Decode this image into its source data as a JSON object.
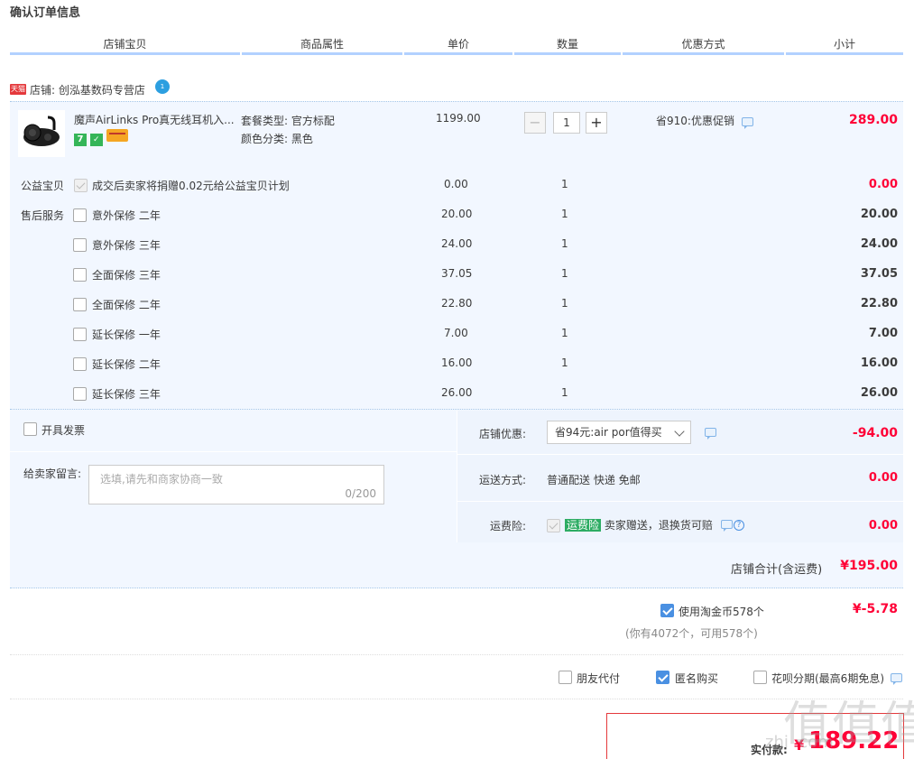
{
  "page_title": "确认订单信息",
  "columns": [
    "店铺宝贝",
    "商品属性",
    "单价",
    "数量",
    "优惠方式",
    "小计"
  ],
  "shop": {
    "badge": "天猫",
    "label": "店铺: 创泓基数码专营店",
    "ww_badge": "1"
  },
  "item": {
    "name": "魔声AirLinks Pro真无线耳机入...",
    "attr1": "套餐类型: 官方标配",
    "attr2": "颜色分类: 黑色",
    "price": "1199.00",
    "qty": "1",
    "discount": "省910:优惠促销",
    "subtotal": "289.00",
    "badge_icons": [
      "7-day-return-icon",
      "guarantee-icon",
      "credit-card-icon"
    ]
  },
  "charity": {
    "label": "公益宝贝",
    "desc": "成交后卖家将捐赠0.02元给公益宝贝计划",
    "price": "0.00",
    "qty": "1",
    "subtotal": "0.00"
  },
  "aftersale": {
    "label": "售后服务",
    "options": [
      {
        "name": "意外保修 二年",
        "price": "20.00",
        "qty": "1",
        "subtotal": "20.00"
      },
      {
        "name": "意外保修 三年",
        "price": "24.00",
        "qty": "1",
        "subtotal": "24.00"
      },
      {
        "name": "全面保修 三年",
        "price": "37.05",
        "qty": "1",
        "subtotal": "37.05"
      },
      {
        "name": "全面保修 二年",
        "price": "22.80",
        "qty": "1",
        "subtotal": "22.80"
      },
      {
        "name": "延长保修 一年",
        "price": "7.00",
        "qty": "1",
        "subtotal": "7.00"
      },
      {
        "name": "延长保修 二年",
        "price": "16.00",
        "qty": "1",
        "subtotal": "16.00"
      },
      {
        "name": "延长保修 三年",
        "price": "26.00",
        "qty": "1",
        "subtotal": "26.00"
      }
    ]
  },
  "invoice": {
    "label": "开具发票"
  },
  "message": {
    "label": "给卖家留言:",
    "placeholder": "选填,请先和商家协商一致",
    "counter": "0/200"
  },
  "shop_discount": {
    "label": "店铺优惠:",
    "selected": "省94元:air por值得买",
    "amount": "-94.00"
  },
  "shipping": {
    "label": "运送方式:",
    "value": "普通配送 快递 免邮",
    "amount": "0.00"
  },
  "insurance": {
    "label": "运费险:",
    "tag": "运费险",
    "desc": "卖家赠送，退换货可赔",
    "amount": "0.00"
  },
  "shop_total": {
    "label": "店铺合计(含运费)",
    "amount": "¥195.00"
  },
  "coins": {
    "label": "使用淘金币578个",
    "note": "(你有4072个，可用578个)",
    "amount": "¥-5.78",
    "checked": true
  },
  "options": {
    "friend_pay": "朋友代付",
    "anonymous": "匿名购买",
    "huabei": "花呗分期(最高6期免息)"
  },
  "pay": {
    "label": "实付款:",
    "currency": "¥",
    "amount": "189.22"
  },
  "watermark": {
    "logo": "值值值",
    "site": "zhi  .com"
  },
  "colors": {
    "accent_red": "#ff0036",
    "header_line": "#b2d1ff",
    "section_bg": "#f2f7ff",
    "checkbox_blue": "#4a90e2"
  }
}
